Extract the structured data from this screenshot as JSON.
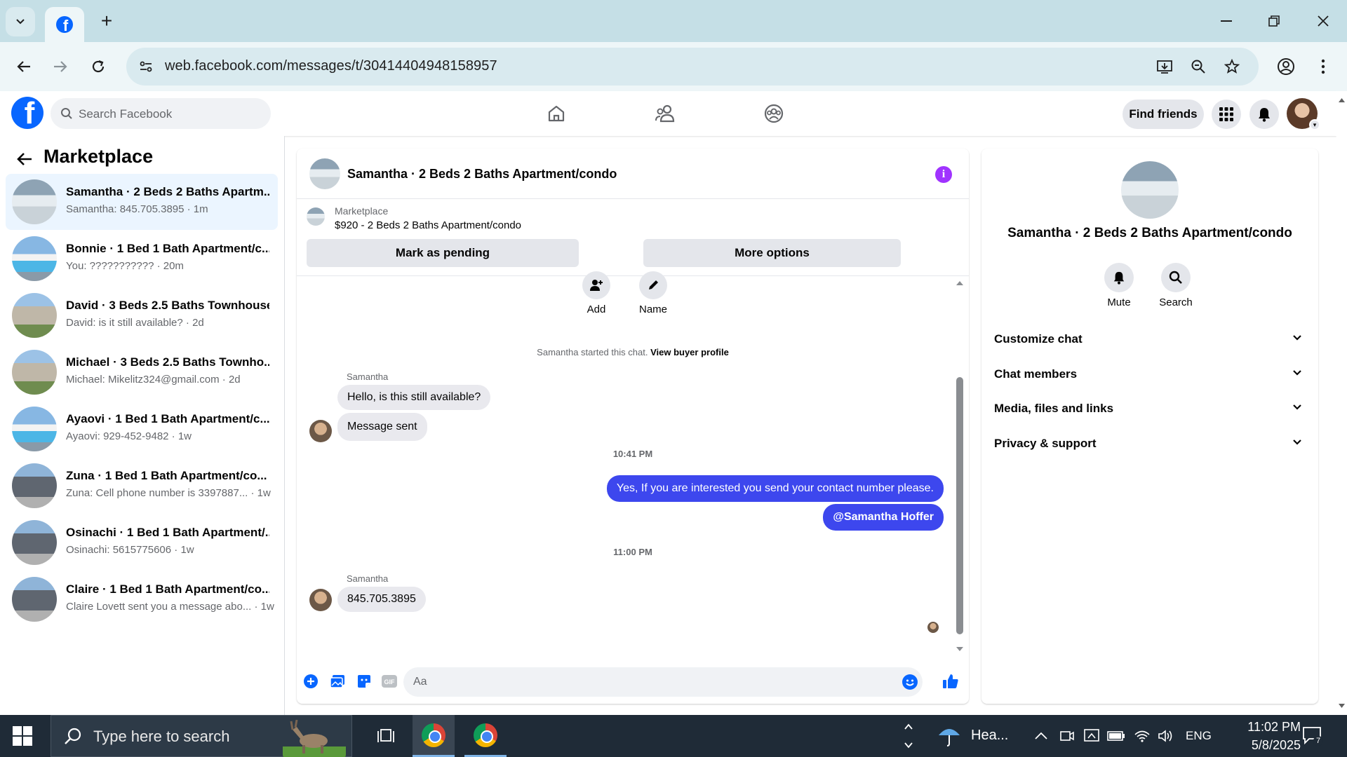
{
  "browser": {
    "url": "web.facebook.com/messages/t/30414404948158957"
  },
  "header": {
    "search_placeholder": "Search Facebook",
    "find_friends": "Find friends"
  },
  "sidebar": {
    "title": "Marketplace",
    "conversations": [
      {
        "title": "Samantha · 2 Beds 2 Baths Apartm...",
        "preview": "Samantha: 845.705.3895 · 1m"
      },
      {
        "title": "Bonnie · 1 Bed 1 Bath Apartment/c...",
        "preview": "You: ??????????? · 20m"
      },
      {
        "title": "David · 3 Beds 2.5 Baths Townhouse",
        "preview": "David: is it still available? · 2d"
      },
      {
        "title": "Michael · 3 Beds 2.5 Baths Townho...",
        "preview": "Michael: Mikelitz324@gmail.com · 2d"
      },
      {
        "title": "Ayaovi · 1 Bed 1 Bath Apartment/c...",
        "preview": "Ayaovi: 929-452-9482 · 1w"
      },
      {
        "title": "Zuna · 1 Bed 1 Bath Apartment/co...",
        "preview": "Zuna: Cell phone number is 3397887... · 1w"
      },
      {
        "title": "Osinachi · 1 Bed 1 Bath Apartment/...",
        "preview": "Osinachi: 5615775606 · 1w"
      },
      {
        "title": "Claire · 1 Bed 1 Bath Apartment/co...",
        "preview": "Claire Lovett sent you a message abo... · 1w"
      }
    ]
  },
  "chat": {
    "title": "Samantha · 2 Beds 2 Baths Apartment/condo",
    "marketplace_label": "Marketplace",
    "listing": "$920 - 2 Beds 2 Baths Apartment/condo",
    "mark_pending": "Mark as pending",
    "more_options": "More options",
    "action_add": "Add",
    "action_name": "Name",
    "started_text": "Samantha started this chat.",
    "view_profile": "View buyer profile",
    "sender_1": "Samantha",
    "msg_1": "Hello, is this still available?",
    "msg_2": "Message sent",
    "time_1": "10:41 PM",
    "msg_3": "Yes, If you  are  interested you send your contact number please.",
    "msg_4": "@Samantha Hoffer",
    "time_2": "11:00 PM",
    "sender_2": "Samantha",
    "msg_5": "845.705.3895",
    "composer_placeholder": "Aa",
    "accent": "#3d47ee"
  },
  "info_panel": {
    "title": "Samantha · 2 Beds 2 Baths Apartment/condo",
    "mute": "Mute",
    "search": "Search",
    "sections": [
      "Customize chat",
      "Chat members",
      "Media, files and links",
      "Privacy & support"
    ]
  },
  "taskbar": {
    "search_placeholder": "Type here to search",
    "weather": "Hea...",
    "lang": "ENG",
    "time": "11:02 PM",
    "date": "5/8/2025",
    "notif_count": "7"
  }
}
